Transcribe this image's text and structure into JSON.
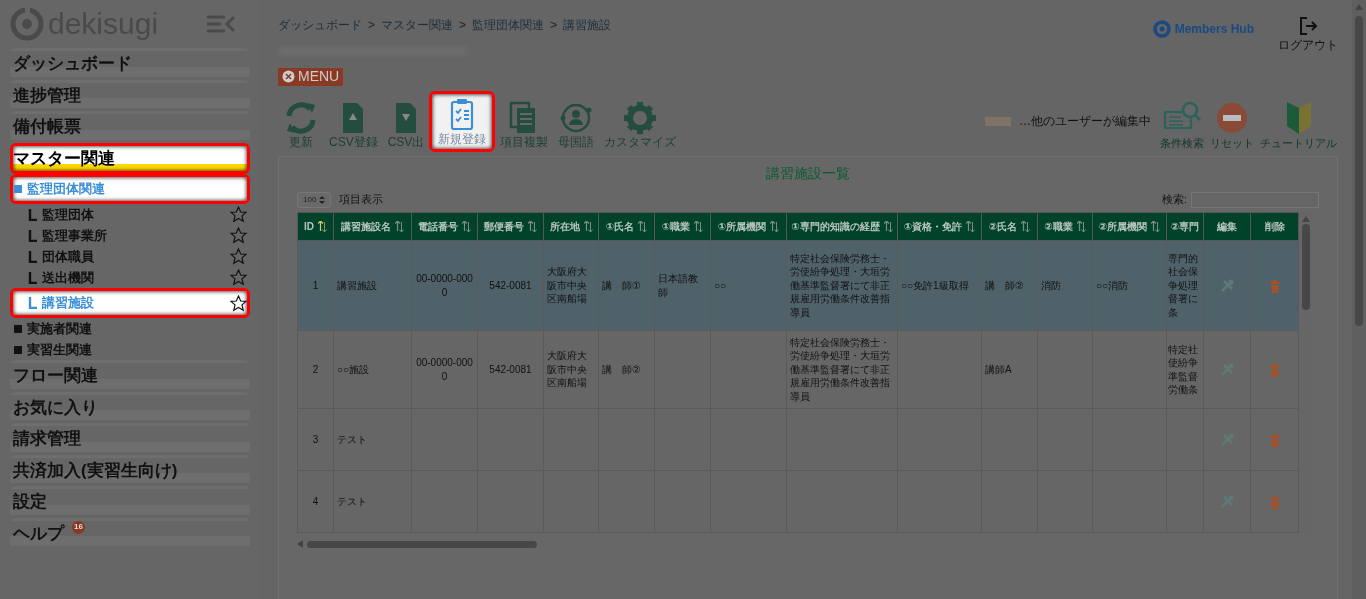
{
  "sidebar": {
    "logo": "dekisugi",
    "items": [
      {
        "kind": "section",
        "label": "ダッシュボード",
        "highlighted": false
      },
      {
        "kind": "section",
        "label": "進捗管理",
        "highlighted": false
      },
      {
        "kind": "section",
        "label": "備付帳票",
        "highlighted": false
      },
      {
        "kind": "section",
        "label": "マスター関連",
        "highlighted": true
      },
      {
        "kind": "group",
        "label": "監理団体関連",
        "highlighted": true
      },
      {
        "kind": "leaf",
        "label": "監理団体",
        "highlighted": false
      },
      {
        "kind": "leaf",
        "label": "監理事業所",
        "highlighted": false
      },
      {
        "kind": "leaf",
        "label": "団体職員",
        "highlighted": false
      },
      {
        "kind": "leaf",
        "label": "送出機関",
        "highlighted": false
      },
      {
        "kind": "leaf",
        "label": "講習施設",
        "highlighted": true
      },
      {
        "kind": "group",
        "label": "実施者関連",
        "highlighted": false
      },
      {
        "kind": "group",
        "label": "実習生関連",
        "highlighted": false
      },
      {
        "kind": "section",
        "label": "フロー関連",
        "highlighted": false
      },
      {
        "kind": "section",
        "label": "お気に入り",
        "highlighted": false
      },
      {
        "kind": "section",
        "label": "請求管理",
        "highlighted": false
      },
      {
        "kind": "section",
        "label": "共済加入(実習生向け)",
        "highlighted": false
      },
      {
        "kind": "section",
        "label": "設定",
        "highlighted": false
      },
      {
        "kind": "section",
        "label": "ヘルプ",
        "badge": "16",
        "highlighted": false
      }
    ]
  },
  "breadcrumb": {
    "separator": ">",
    "items": [
      "ダッシュボード",
      "マスター関連",
      "監理団体関連",
      "講習施設"
    ]
  },
  "brand": "Members Hub",
  "logout": "ログアウト",
  "menu_button": "MENU",
  "toolbar": [
    {
      "kind": "refresh",
      "label": "更新",
      "highlighted": false
    },
    {
      "kind": "csv-import",
      "label": "CSV登録",
      "highlighted": false
    },
    {
      "kind": "csv-export",
      "label": "CSV出",
      "highlighted": false
    },
    {
      "kind": "new",
      "label": "新規登録",
      "highlighted": true
    },
    {
      "kind": "copy",
      "label": "項目複製",
      "highlighted": false
    },
    {
      "kind": "language",
      "label": "母国語",
      "highlighted": false
    },
    {
      "kind": "customize",
      "label": "カスタマイズ",
      "highlighted": false
    }
  ],
  "legend": "…他のユーザーが編集中",
  "right_tools": [
    {
      "kind": "search",
      "label": "条件検索"
    },
    {
      "kind": "reset",
      "label": "リセット"
    },
    {
      "kind": "tutorial",
      "label": "チュートリアル"
    }
  ],
  "panel": {
    "title": "講習施設一覧",
    "page_size": "100",
    "page_size_label": "項目表示",
    "search_label": "検索:",
    "columns": [
      {
        "kind": "sortable",
        "label": "ID",
        "sorted": true
      },
      {
        "kind": "sortable",
        "label": "講習施設名",
        "sorted": false
      },
      {
        "kind": "sortable",
        "label": "電話番号",
        "sorted": false
      },
      {
        "kind": "sortable",
        "label": "郵便番号",
        "sorted": false
      },
      {
        "kind": "sortable",
        "label": "所在地",
        "sorted": false
      },
      {
        "kind": "sortable",
        "label": "①氏名",
        "sorted": false
      },
      {
        "kind": "sortable",
        "label": "①職業",
        "sorted": false
      },
      {
        "kind": "sortable",
        "label": "①所属機関",
        "sorted": false
      },
      {
        "kind": "sortable",
        "label": "①専門的知識の経歴",
        "sorted": false
      },
      {
        "kind": "sortable",
        "label": "①資格・免許",
        "sorted": false
      },
      {
        "kind": "sortable",
        "label": "②氏名",
        "sorted": false
      },
      {
        "kind": "sortable",
        "label": "②職業",
        "sorted": false
      },
      {
        "kind": "sortable",
        "label": "②所属機関",
        "sorted": false
      },
      {
        "kind": "text",
        "label": "②専門"
      },
      {
        "kind": "edit",
        "label": "編集"
      },
      {
        "kind": "delete",
        "label": "削除"
      }
    ],
    "rows": [
      {
        "selected": true,
        "cells": [
          "1",
          "講習施設",
          "00-0000-0000",
          "542-0081",
          "大阪府大阪市中央区南船場",
          "講　師①",
          "日本語教師",
          "○○",
          "特定社会保険労務士・労使紛争処理・大垣労働基準監督署にて非正規雇用労働条件改善指導員",
          "○○免許1級取得",
          "講　師②",
          "消防",
          "○○消防",
          "専門的社会保争処理督署に条"
        ]
      },
      {
        "selected": false,
        "cells": [
          "2",
          "○○施設",
          "00-0000-0000",
          "542-0081",
          "大阪府大阪市中央区南船場",
          "講　師②",
          "",
          "",
          "特定社会保険労務士・労使紛争処理・大垣労働基準監督署にて非正規雇用労働条件改善指導員",
          "",
          "講師A",
          "",
          "",
          "特定社使紛争準監督労働条"
        ]
      },
      {
        "selected": false,
        "cells": [
          "3",
          "テスト",
          "",
          "",
          "",
          "",
          "",
          "",
          "",
          "",
          "",
          "",
          "",
          ""
        ]
      },
      {
        "selected": false,
        "cells": [
          "4",
          "テスト",
          "",
          "",
          "",
          "",
          "",
          "",
          "",
          "",
          "",
          "",
          "",
          ""
        ]
      }
    ]
  }
}
